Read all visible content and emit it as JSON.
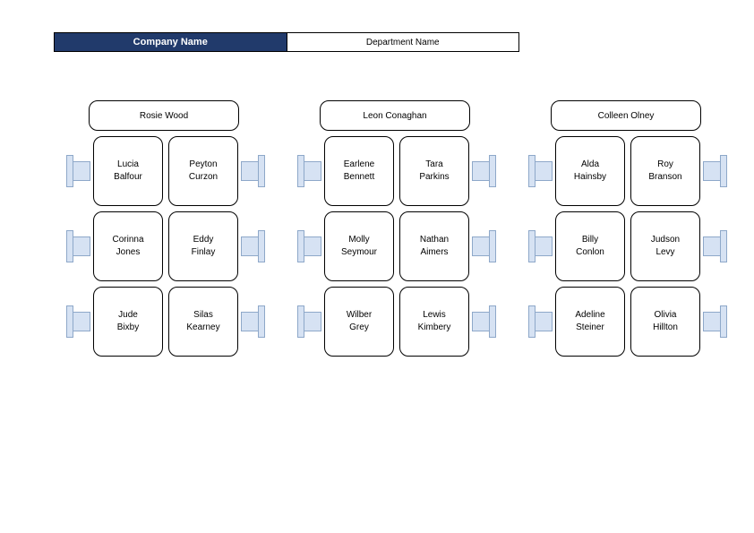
{
  "header": {
    "company": "Company Name",
    "department": "Department Name"
  },
  "clusters": [
    {
      "head": "Rosie Wood",
      "rows": [
        {
          "left": "Lucia Balfour",
          "right": "Peyton Curzon"
        },
        {
          "left": "Corinna Jones",
          "right": "Eddy Finlay"
        },
        {
          "left": "Jude Bixby",
          "right": "Silas Kearney"
        }
      ]
    },
    {
      "head": "Leon Conaghan",
      "rows": [
        {
          "left": "Earlene Bennett",
          "right": "Tara Parkins"
        },
        {
          "left": "Molly Seymour",
          "right": "Nathan Aimers"
        },
        {
          "left": "Wilber Grey",
          "right": "Lewis Kimbery"
        }
      ]
    },
    {
      "head": "Colleen Olney",
      "rows": [
        {
          "left": "Alda Hainsby",
          "right": "Roy Branson"
        },
        {
          "left": "Billy Conlon",
          "right": "Judson Levy"
        },
        {
          "left": "Adeline Steiner",
          "right": "Olivia Hillton"
        }
      ]
    }
  ]
}
